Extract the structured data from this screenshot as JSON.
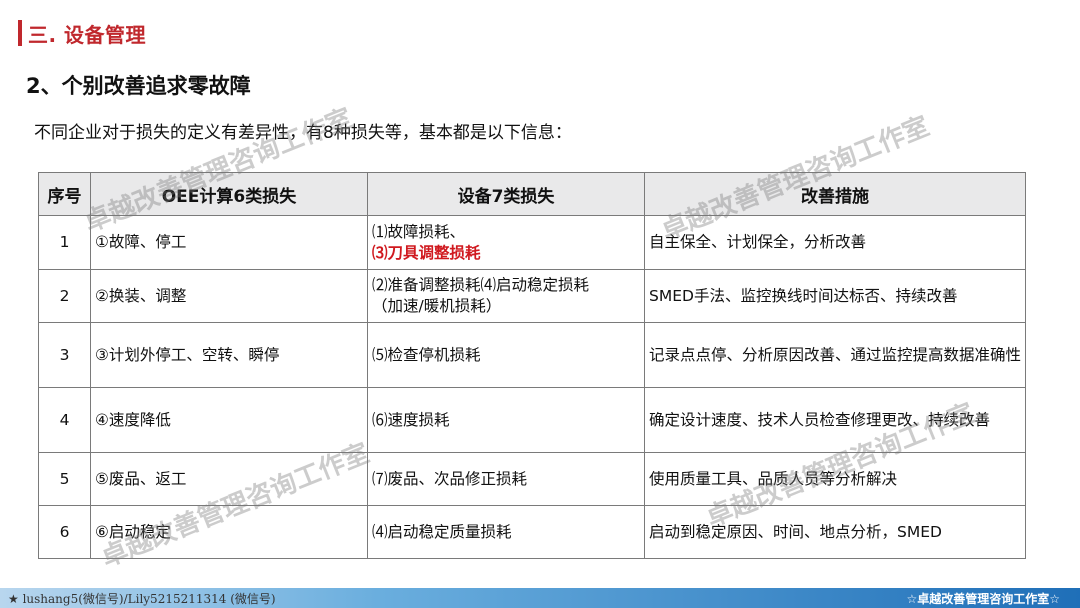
{
  "section": {
    "title": "三. 设备管理"
  },
  "subtitle": "2、个别改善追求零故障",
  "intro": "不同企业对于损失的定义有差异性，有8种损失等，基本都是以下信息：",
  "table": {
    "headers": [
      "序号",
      "OEE计算6类损失",
      "设备7类损失",
      "改善措施"
    ],
    "rows": [
      {
        "num": "1",
        "oee": "①故障、停工",
        "equip_line1": "⑴故障损耗、",
        "equip_line2": "⑶刀具调整损耗",
        "measure": "自主保全、计划保全，分析改善"
      },
      {
        "num": "2",
        "oee": "②换装、调整",
        "equip_line1": "⑵准备调整损耗⑷启动稳定损耗",
        "equip_line2": "（加速/暖机损耗）",
        "measure": "SMED手法、监控换线时间达标否、持续改善"
      },
      {
        "num": "3",
        "oee": "③计划外停工、空转、瞬停",
        "equip": "⑸检查停机损耗",
        "measure": "记录点点停、分析原因改善、通过监控提高数据准确性"
      },
      {
        "num": "4",
        "oee": "④速度降低",
        "equip": "⑹速度损耗",
        "measure": "确定设计速度、技术人员检查修理更改、持续改善"
      },
      {
        "num": "5",
        "oee": "⑤废品、返工",
        "equip": "⑺废品、次品修正损耗",
        "measure": "使用质量工具、品质人员等分析解决"
      },
      {
        "num": "6",
        "oee": "⑥启动稳定",
        "equip": "⑷启动稳定质量损耗",
        "measure": "启动到稳定原因、时间、地点分析，SMED"
      }
    ]
  },
  "watermark": "卓越改善管理咨询工作室",
  "footer": {
    "left": "★ lushang5(微信号)/Lily5215211314 (微信号)",
    "right": "☆卓越改善管理咨询工作室☆"
  },
  "colors": {
    "accent": "#c0282d",
    "highlight": "#d0191f",
    "footer_dark": "#1f6fb8"
  }
}
